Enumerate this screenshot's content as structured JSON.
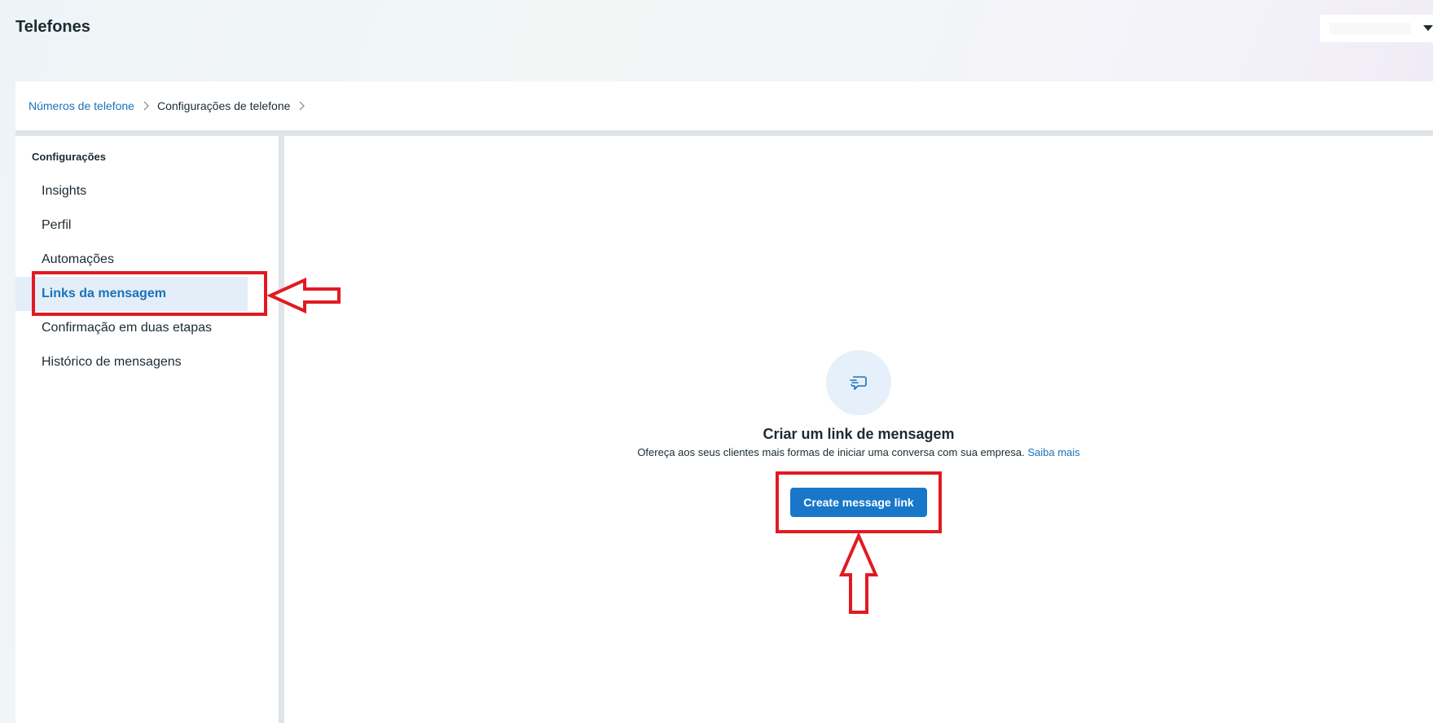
{
  "header": {
    "title": "Telefones"
  },
  "breadcrumb": {
    "items": [
      "Números de telefone",
      "Configurações de telefone"
    ]
  },
  "sidebar": {
    "heading": "Configurações",
    "items": [
      {
        "label": "Insights"
      },
      {
        "label": "Perfil"
      },
      {
        "label": "Automações"
      },
      {
        "label": "Links da mensagem"
      },
      {
        "label": "Confirmação em duas etapas"
      },
      {
        "label": "Histórico de mensagens"
      }
    ],
    "active_label": "Links da mensagem"
  },
  "empty_state": {
    "icon": "message-link-icon",
    "title": "Criar um link de mensagem",
    "description": "Ofereça aos seus clientes mais formas de iniciar uma conversa com sua empresa.",
    "link_label": "Saiba mais",
    "button_label": "Create message link"
  },
  "colors": {
    "accent": "#1877c9",
    "link": "#1a72b8",
    "annotation": "#e11a22",
    "active_bg": "#e3eef8"
  }
}
